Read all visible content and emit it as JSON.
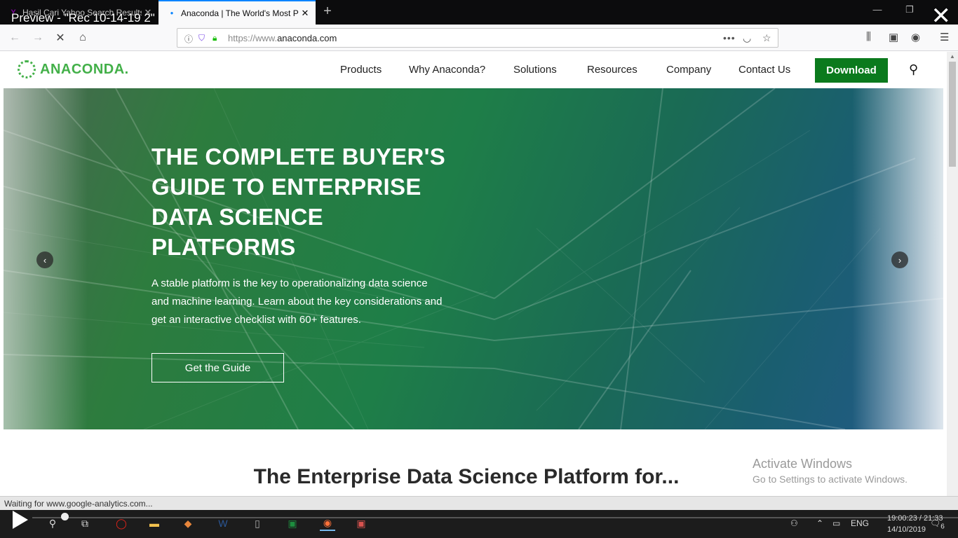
{
  "browser": {
    "tabs": [
      {
        "label": "Hasil Cari Yahoo Search Results",
        "favicon": "Y",
        "active": false
      },
      {
        "label": "Anaconda | The World's Most Popular",
        "favicon": "●",
        "active": true
      }
    ],
    "new_tab_icon": "+",
    "url_prefix": "https://www.",
    "url_domain": "anaconda.com",
    "overlay_title": "Preview - \"Rec 10-14-19 2\"",
    "window_controls": [
      "—",
      "❐",
      "✕"
    ]
  },
  "site": {
    "logo_text": "ANACONDA.",
    "menu": [
      "Products",
      "Why Anaconda?",
      "Solutions",
      "Resources",
      "Company",
      "Contact Us"
    ],
    "download_label": "Download",
    "accent_color": "#43b049",
    "download_color": "#0b7a1d"
  },
  "hero": {
    "title_lines": [
      "THE COMPLETE BUYER'S",
      "GUIDE TO ENTERPRISE",
      "DATA SCIENCE",
      "PLATFORMS"
    ],
    "body_lines": [
      "A stable platform is the key to operationalizing data science",
      "and machine learning. Learn about the key considerations and",
      "get an interactive checklist with 60+ features."
    ],
    "cta_label": "Get the Guide",
    "prev_icon": "‹",
    "next_icon": "›"
  },
  "section": {
    "title": "The Enterprise Data Science Platform for..."
  },
  "watermark": {
    "line1": "Activate Windows",
    "line2": "Go to Settings to activate Windows."
  },
  "status": {
    "text": "Waiting for www.google-analytics.com..."
  },
  "taskbar": {
    "lang": "ENG",
    "time_overlay": "00:23 / 21:33",
    "time_prefix": "19:",
    "date": "14/10/2019",
    "notification_count": "6"
  }
}
